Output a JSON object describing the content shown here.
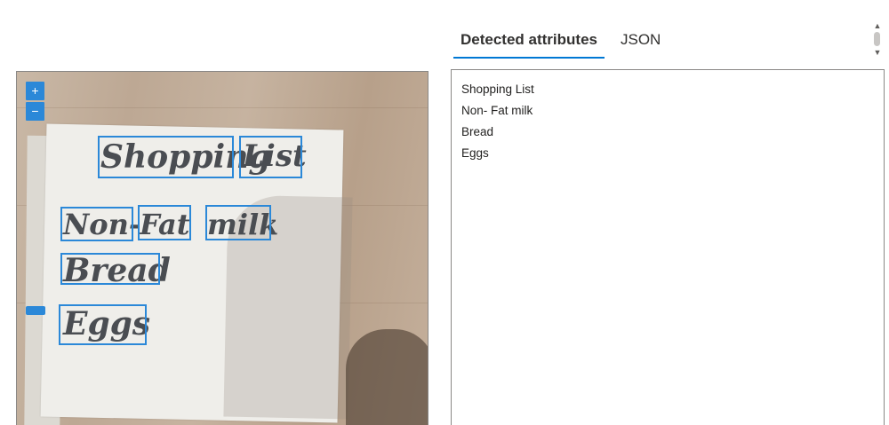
{
  "tabs": [
    {
      "label": "Detected attributes",
      "active": true
    },
    {
      "label": "JSON",
      "active": false
    }
  ],
  "viewer": {
    "zoom_in_label": "+",
    "zoom_out_label": "−",
    "handwriting": [
      {
        "text": "Shopping"
      },
      {
        "text": "List"
      },
      {
        "text": "Non-"
      },
      {
        "text": "Fat"
      },
      {
        "text": "milk"
      },
      {
        "text": "Bread"
      },
      {
        "text": "Eggs"
      }
    ]
  },
  "results": {
    "lines": [
      "Shopping List",
      "Non- Fat milk",
      "Bread",
      "Eggs"
    ]
  },
  "colors": {
    "accent": "#0078d4",
    "bbox": "#2b88d8",
    "border": "#8a8886"
  },
  "icons": {
    "scroll_up": "chevron-up-icon",
    "scroll_down": "chevron-down-icon"
  }
}
